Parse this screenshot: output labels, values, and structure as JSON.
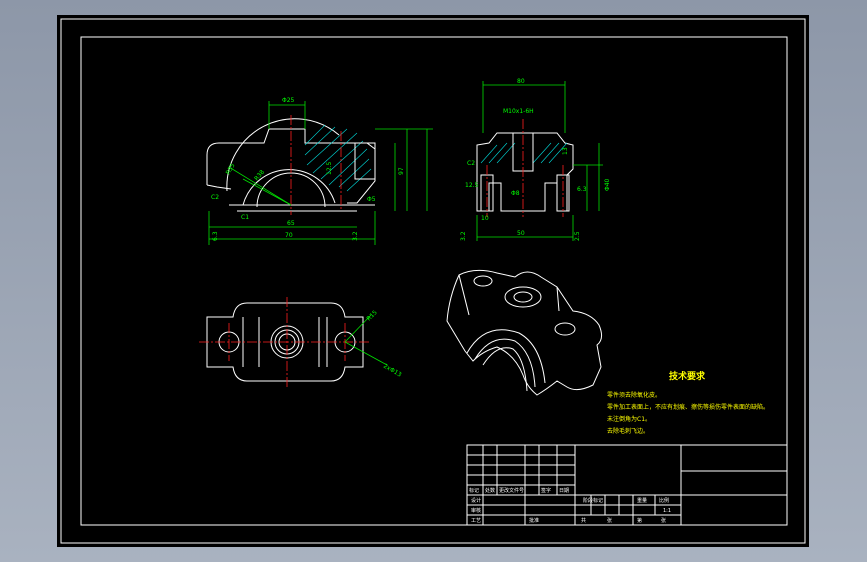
{
  "drawing": {
    "notes": {
      "title": "技术要求",
      "lines": [
        "零件须去除氧化皮。",
        "零件加工表面上，不应有划痕、擦伤等损伤零件表面的缺陷。",
        "未注倒角为C1。",
        "去除毛刺飞边。"
      ]
    },
    "front_view": {
      "dims": [
        "Φ25",
        "65",
        "70",
        "97",
        "R55",
        "R38",
        "C2",
        "C1",
        "6.3",
        "12.5",
        "3.2",
        "Φ5"
      ]
    },
    "side_view": {
      "dims": [
        "80",
        "M10x1-6H",
        "50",
        "10",
        "13",
        "Φ8",
        "Φ40",
        "C2",
        "12.5",
        "6.3",
        "3.2",
        "2.5"
      ]
    },
    "plan_view": {
      "dims": [
        "R15",
        "2xΦ13"
      ]
    },
    "title_block": {
      "scale": "1:1",
      "labels": [
        "标记",
        "处数",
        "更改文件号",
        "签字",
        "日期",
        "设计",
        "审核",
        "工艺",
        "批准",
        "阶段标记",
        "重量",
        "比例",
        "共",
        "张",
        "第",
        "张"
      ]
    },
    "colors": {
      "background": "#000000",
      "outline": "#ffffff",
      "dimension": "#00e000",
      "centerline": "#ff2020",
      "hatch": "#00d8d8",
      "notes": "#ffff00"
    }
  }
}
